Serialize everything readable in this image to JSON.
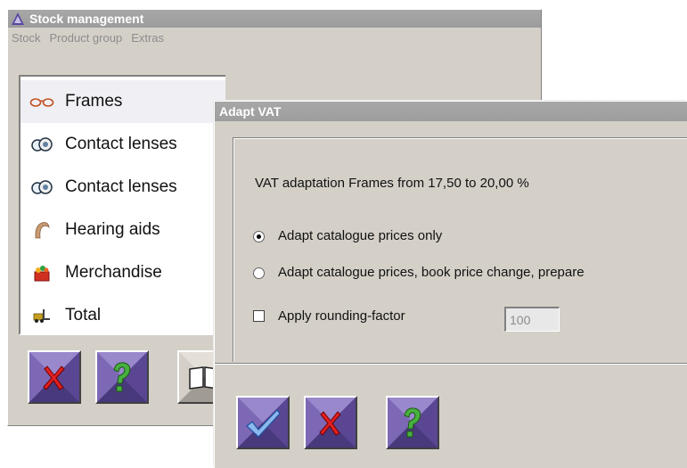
{
  "main_window": {
    "title": "Stock management",
    "menu": [
      "Stock",
      "Product group",
      "Extras"
    ],
    "product_groups": [
      {
        "label": "Frames",
        "icon": "glasses-icon",
        "selected": true
      },
      {
        "label": "Contact lenses",
        "icon": "contact-lens-icon",
        "selected": false
      },
      {
        "label": "Contact lenses",
        "icon": "contact-lens-icon",
        "selected": false
      },
      {
        "label": "Hearing aids",
        "icon": "hearing-aid-icon",
        "selected": false
      },
      {
        "label": "Merchandise",
        "icon": "basket-icon",
        "selected": false
      },
      {
        "label": "Total",
        "icon": "forklift-icon",
        "selected": false
      }
    ],
    "buttons": [
      "cancel-icon",
      "help-icon",
      "book-icon"
    ]
  },
  "dialog": {
    "title": "Adapt VAT",
    "message": "VAT adaptation Frames from 17,50 to 20,00 %",
    "option_prices_only": "Adapt catalogue prices only",
    "option_full": "Adapt catalogue prices, book price change, prepare",
    "selected_option": "option_prices_only",
    "rounding_label": "Apply rounding-factor",
    "rounding_checked": false,
    "rounding_value": "100",
    "buttons": [
      "ok-icon",
      "cancel-icon",
      "help-icon"
    ]
  },
  "colors": {
    "button_face": "#6e5aa6",
    "window_bg": "#d4d0c8",
    "titlebar": "#a7a7a7"
  }
}
